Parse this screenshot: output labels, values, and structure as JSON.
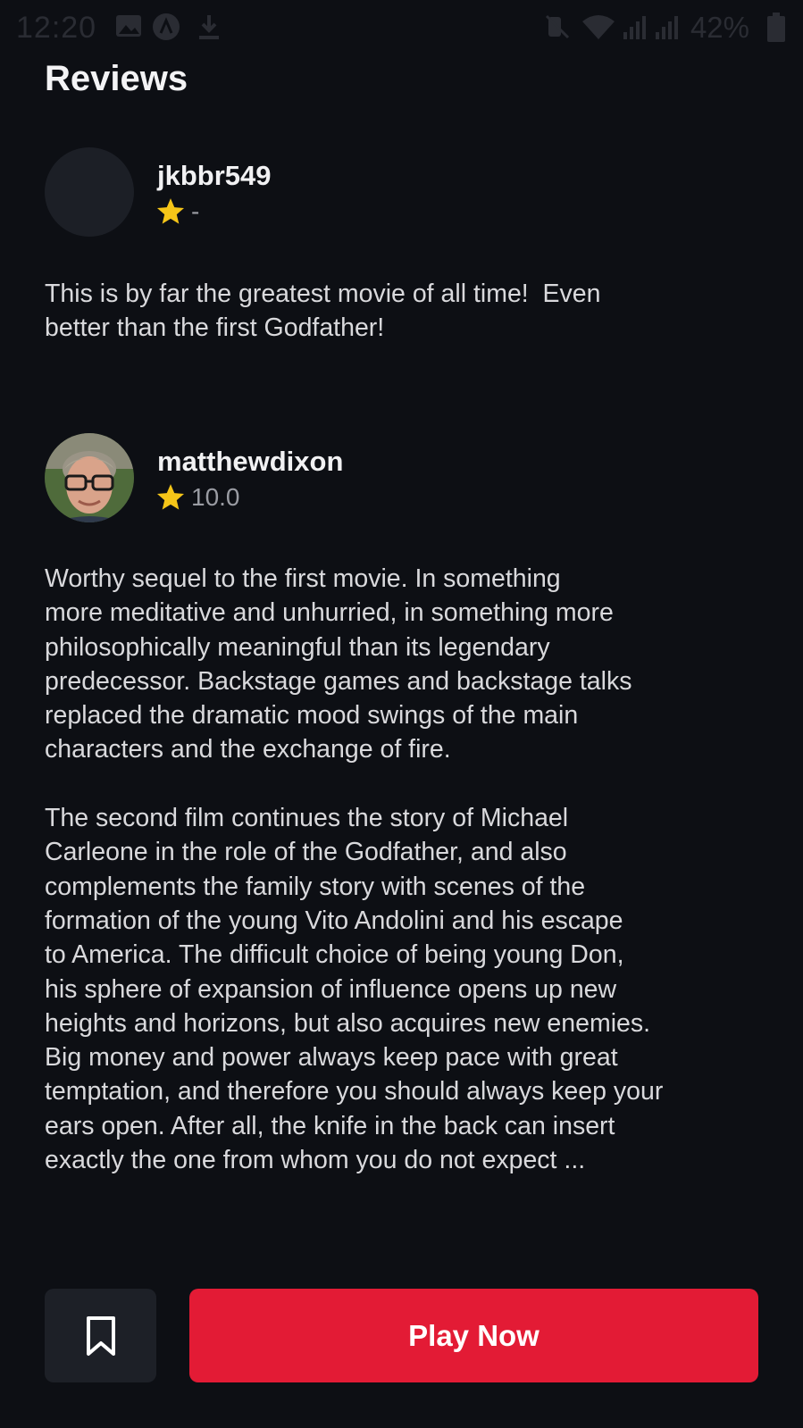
{
  "status_bar": {
    "time": "12:20",
    "battery": "42%",
    "icons": [
      "gallery-icon",
      "app-notification-icon",
      "download-icon",
      "mute-icon",
      "wifi-icon",
      "signal-icon",
      "signal-icon",
      "battery-icon"
    ]
  },
  "section_title": "Reviews",
  "reviews": [
    {
      "author": "jkbbr549",
      "rating": "-",
      "content": "This is by far the greatest movie of all time!  Even\nbetter than the first Godfather!"
    },
    {
      "author": "matthewdixon",
      "rating": "10.0",
      "content": "Worthy sequel to the first movie. In something\nmore meditative and unhurried, in something more\nphilosophically meaningful than its legendary\npredecessor. Backstage games and backstage talks\nreplaced the dramatic mood swings of the main\ncharacters and the exchange of fire.\n\nThe second film continues the story of Michael\nCarleone in the role of the Godfather, and also\ncomplements the family story with scenes of the\nformation of the young Vito Andolini and his escape\nto America. The difficult choice of being young Don,\nhis sphere of expansion of influence opens up new\nheights and horizons, but also acquires new enemies.\nBig money and power always keep pace with great\ntemptation, and therefore you should always keep your\nears open. After all, the knife in the back can insert\nexactly the one from whom you do not expect ..."
    }
  ],
  "actions": {
    "bookmark_icon": "bookmark-icon",
    "play_label": "Play Now"
  },
  "colors": {
    "background": "#0d0f14",
    "accent": "#e31b35",
    "star": "#f5c518",
    "surface": "#1d2027"
  }
}
